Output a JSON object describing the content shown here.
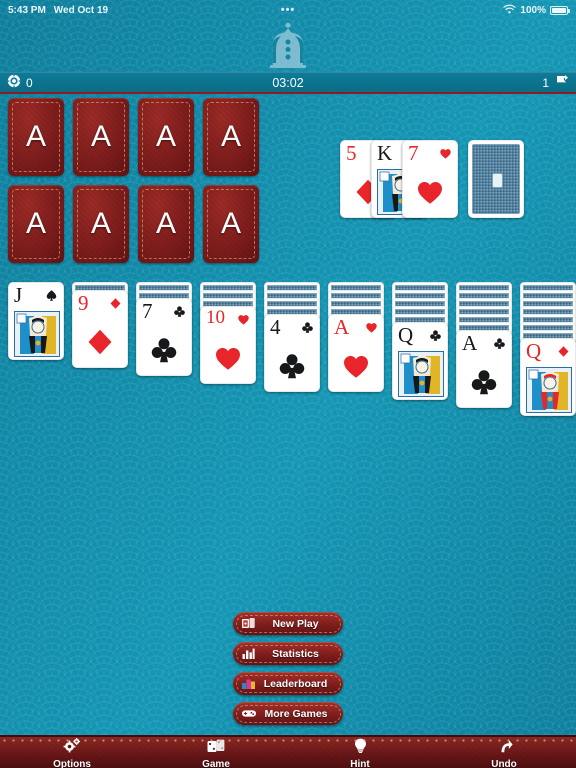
{
  "status_bar": {
    "time": "5:43 PM",
    "date": "Wed Oct 19",
    "dots": "•••",
    "battery_percent": "100%",
    "wifi_icon": "wifi-icon",
    "battery_icon": "battery-icon"
  },
  "app": {
    "logo_icon": "crown-logo-icon",
    "background_color": "#0e87a5",
    "accent_red": "#8e2823"
  },
  "header": {
    "score_icon": "score-gear-icon",
    "score": "0",
    "timer": "03:02",
    "moves": "1",
    "moves_icon": "moves-flag-icon"
  },
  "foundations": {
    "slot_label": "A",
    "slots": [
      {
        "id": "foundation-1"
      },
      {
        "id": "foundation-2"
      },
      {
        "id": "foundation-3"
      },
      {
        "id": "foundation-4"
      },
      {
        "id": "foundation-5"
      },
      {
        "id": "foundation-6"
      },
      {
        "id": "foundation-7"
      },
      {
        "id": "foundation-8"
      }
    ]
  },
  "waste_pile": {
    "cards": [
      {
        "rank": "5",
        "suit": "♦",
        "color": "red",
        "face": false
      },
      {
        "rank": "K",
        "suit": "♠",
        "color": "black",
        "face": true
      },
      {
        "rank": "7",
        "suit": "♥",
        "color": "red",
        "face": false
      }
    ]
  },
  "stock_pile": {
    "face_down": true,
    "label": "stock-card-back"
  },
  "tableau": {
    "columns": [
      {
        "facedown": 0,
        "rank": "J",
        "suit": "♠",
        "color": "black",
        "face": true
      },
      {
        "facedown": 1,
        "rank": "9",
        "suit": "♦",
        "color": "red",
        "face": false
      },
      {
        "facedown": 2,
        "rank": "7",
        "suit": "♣",
        "color": "black",
        "face": false
      },
      {
        "facedown": 3,
        "rank": "10",
        "suit": "♥",
        "color": "red",
        "face": false
      },
      {
        "facedown": 4,
        "rank": "4",
        "suit": "♣",
        "color": "black",
        "face": false
      },
      {
        "facedown": 4,
        "rank": "A",
        "suit": "♥",
        "color": "red",
        "face": false
      },
      {
        "facedown": 5,
        "rank": "Q",
        "suit": "♣",
        "color": "black",
        "face": true
      },
      {
        "facedown": 6,
        "rank": "A",
        "suit": "♣",
        "color": "black",
        "face": false
      },
      {
        "facedown": 7,
        "rank": "Q",
        "suit": "♦",
        "color": "red",
        "face": true
      }
    ]
  },
  "menu_buttons": [
    {
      "label": "New Play",
      "icon": "cards-icon"
    },
    {
      "label": "Statistics",
      "icon": "bar-chart-icon"
    },
    {
      "label": "Leaderboard",
      "icon": "podium-icon"
    },
    {
      "label": "More Games",
      "icon": "gamepad-icon"
    }
  ],
  "toolbar": [
    {
      "label": "Options",
      "icon": "gears-icon"
    },
    {
      "label": "Game",
      "icon": "dice-cards-icon"
    },
    {
      "label": "Hint",
      "icon": "lightbulb-icon"
    },
    {
      "label": "Undo",
      "icon": "undo-arrow-icon"
    }
  ]
}
